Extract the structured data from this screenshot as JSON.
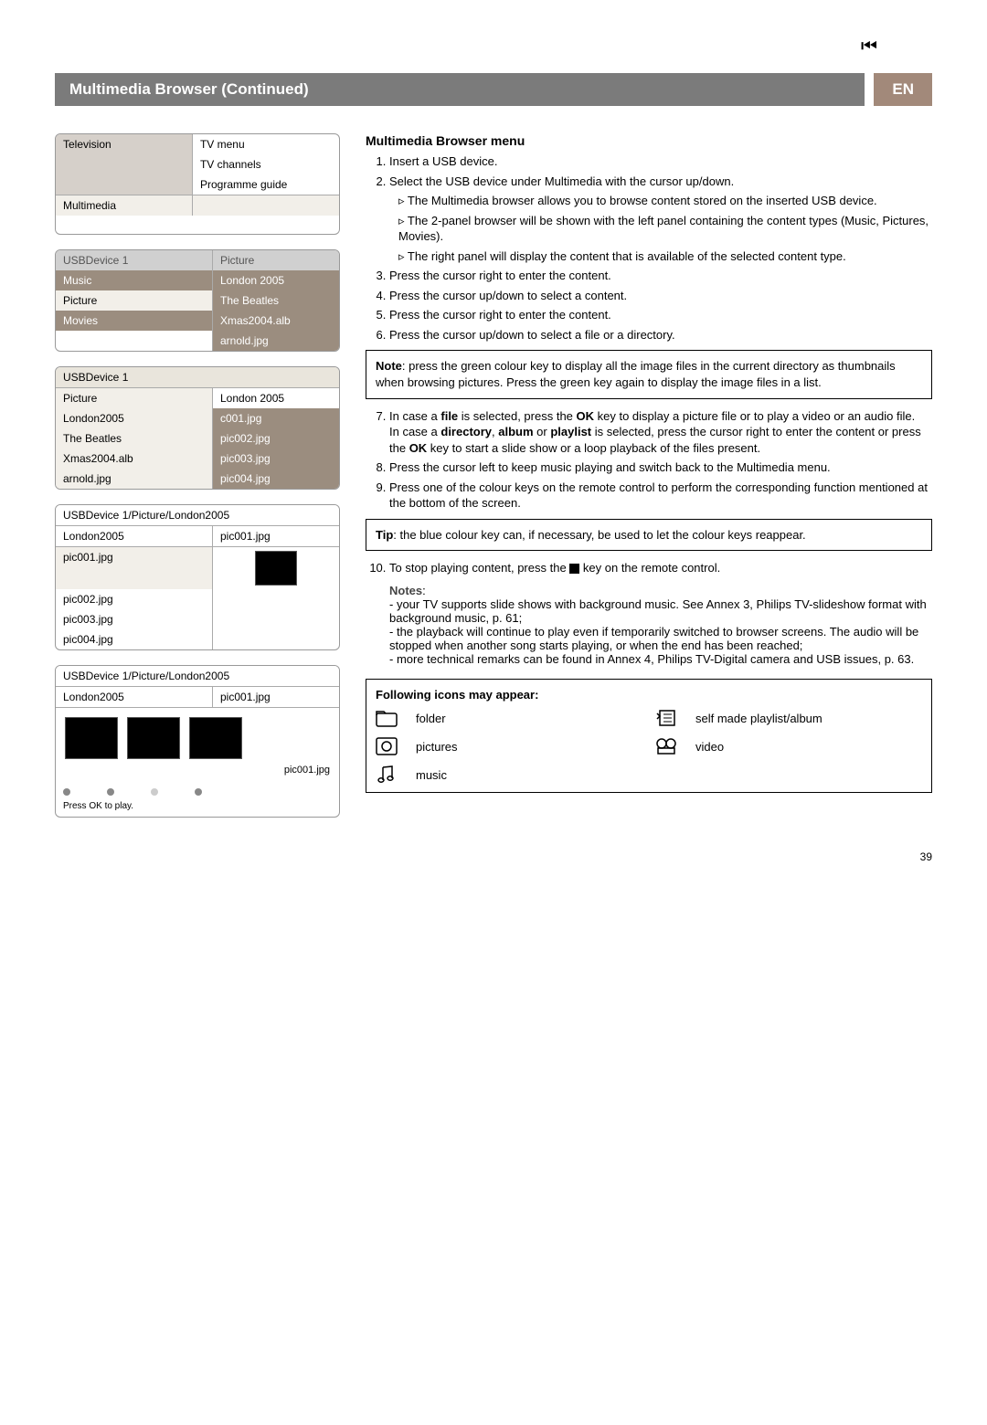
{
  "header": {
    "title": "Multimedia Browser   (Continued)",
    "lang": "EN"
  },
  "nav_icon": "⏮",
  "page_number": "39",
  "panel1": {
    "left": [
      "Television",
      "",
      "",
      "Multimedia"
    ],
    "right": [
      "TV menu",
      "TV channels",
      "Programme guide",
      ""
    ]
  },
  "panel2": {
    "head_left": "USBDevice 1",
    "head_right": "Picture",
    "rows_left": [
      "Music",
      "Picture",
      "Movies",
      ""
    ],
    "rows_right": [
      "London 2005",
      "The Beatles",
      "Xmas2004.alb",
      "arnold.jpg"
    ]
  },
  "panel3": {
    "head": "USBDevice 1",
    "rows_left": [
      "Picture",
      "London2005",
      "The Beatles",
      "Xmas2004.alb",
      "arnold.jpg"
    ],
    "rows_right": [
      "London 2005",
      "c001.jpg",
      "pic002.jpg",
      "pic003.jpg",
      "pic004.jpg"
    ]
  },
  "panel4": {
    "path": "USBDevice 1/Picture/London2005",
    "head_left": "London2005",
    "head_right": "pic001.jpg",
    "items": [
      "pic001.jpg",
      "pic002.jpg",
      "pic003.jpg",
      "pic004.jpg"
    ]
  },
  "panel5": {
    "path": "USBDevice 1/Picture/London2005",
    "head_left": "London2005",
    "head_right": "pic001.jpg",
    "thumb_label": "pic001.jpg",
    "press": "Press OK to play."
  },
  "menu": {
    "title": "Multimedia Browser menu",
    "steps": [
      "Insert a USB device.",
      "Select the USB device under Multimedia with the cursor up/down.",
      "Press the cursor right to enter the content.",
      "Press the cursor up/down to select a content.",
      "Press the cursor right to enter the content.",
      "Press the cursor up/down to select a file or a directory."
    ],
    "bullets": [
      "The Multimedia browser allows you to browse content stored on the inserted USB device.",
      "The 2-panel browser will be shown with the left panel containing the content types (Music, Pictures, Movies).",
      "The right panel will display the content that is available of the selected content type."
    ],
    "box1_prefix": "Note",
    "box1": ": press the green colour key to display all the image files in the current directory as thumbnails when browsing pictures. Press the green key again to display the image files in a list.",
    "step7a_prefix": "In case a ",
    "step7a_bold1": "file",
    "step7a_mid": " is selected, press the ",
    "step7a_bold2": "OK",
    "step7a_end": " key to display a picture file or to play a video or an audio file.",
    "step7b_prefix": "In case a ",
    "step7b_bold1": "directory",
    "step7b_b1c": ", ",
    "step7b_bold2": "album",
    "step7b_b2c": " or ",
    "step7b_bold3": "playlist",
    "step7b_mid": " is selected, press the cursor right to enter the content or press the ",
    "step7b_bold4": "OK",
    "step7b_end": " key to start a slide show or a loop playback of the files present.",
    "step8": "Press the cursor left to keep music playing and switch back to the Multimedia menu.",
    "step9": "Press one of the colour keys on the remote control to perform the corresponding function mentioned at the bottom of the screen.",
    "box2_prefix": "Tip",
    "box2": ": the blue colour key can, if necessary, be used to let the colour keys reappear.",
    "step10a": "To stop playing content, press the ",
    "step10b": " key on the remote control.",
    "notes_title": "Notes",
    "notes": [
      "your TV supports slide shows with background music. See Annex 3, Philips TV-slideshow format with background music, p. 61;",
      "the playback will continue to play even if temporarily switched to browser screens. The audio will be stopped when another song starts playing, or when the end has been reached;",
      "more technical remarks can be found in Annex 4, Philips TV-Digital camera and USB issues, p. 63."
    ]
  },
  "icons_box": {
    "title": "Following icons may appear:",
    "items": [
      "folder",
      "self made playlist/album",
      "pictures",
      "video",
      "music"
    ]
  }
}
